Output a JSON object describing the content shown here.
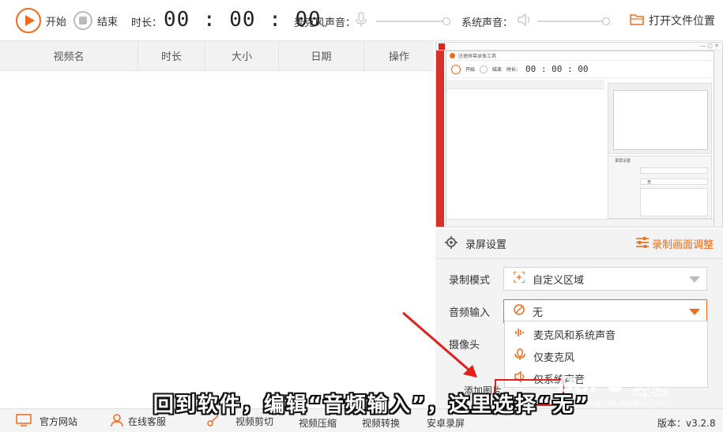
{
  "toolbar": {
    "start_label": "开始",
    "end_label": "结束",
    "duration_label": "时长：",
    "duration_value": "00 : 00 : 00",
    "mic_label": "麦克风声音：",
    "system_label": "系统声音：",
    "open_folder_label": "打开文件位置"
  },
  "list": {
    "columns": [
      "视频名",
      "时长",
      "大小",
      "日期",
      "操作"
    ]
  },
  "preview": {
    "mini_title": "迅捷屏幕录像工具",
    "mini_start": "开始",
    "mini_end": "结束",
    "mini_duration": "时长：",
    "mini_time": "00 : 00 : 00",
    "mini_settings": "录屏设置",
    "mini_option_none": "无"
  },
  "settings": {
    "title": "录屏设置",
    "adjust_label": "录制画面调整",
    "mode_label": "录制模式",
    "mode_value": "自定义区域",
    "audio_label": "音频输入",
    "audio_value": "无",
    "camera_label": "摄像头",
    "add_image_label": "添加图片",
    "audio_options": [
      "麦克风和系统声音",
      "仅麦克风",
      "仅系统声音"
    ]
  },
  "bottombar": {
    "website": "官方网站",
    "support": "在线客服",
    "video_cut": "视频剪切",
    "video_compress": "视频压缩",
    "video_convert": "视频转换",
    "android_record": "安卓录屏",
    "version": "版本：v3.2.8"
  },
  "overlay": {
    "caption": "回到软件，编辑“音频输入”，这里选择“无”",
    "watermark_brand": "Bai",
    "watermark_suffix": "经验",
    "watermark_url": "jingyan.baidu.com"
  },
  "colors": {
    "accent": "#f26b1d",
    "highlight_box": "#e0201a",
    "arrow": "#e0201a"
  }
}
